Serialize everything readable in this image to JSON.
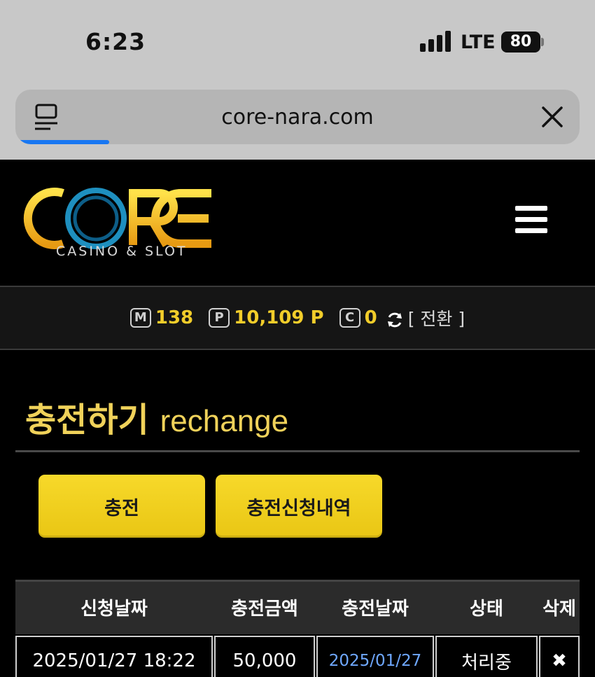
{
  "status_bar": {
    "time": "6:23",
    "network": "LTE",
    "battery": "80"
  },
  "browser": {
    "url": "core-nara.com"
  },
  "site": {
    "logo_text": "CORE",
    "logo_sub": "CASINO & SLOT"
  },
  "balance": {
    "money_icon": "M",
    "money": "138",
    "point_icon": "P",
    "points": "10,109 P",
    "coin_icon": "C",
    "coin": "0",
    "convert_label": "[ 전환 ]"
  },
  "page": {
    "title_ko": "충전하기",
    "title_en": "rechange"
  },
  "buttons": {
    "charge": "충전",
    "history": "충전신청내역"
  },
  "table": {
    "headers": [
      "신청날짜",
      "충전금액",
      "충전날짜",
      "상태",
      "삭제"
    ],
    "rows": [
      {
        "request_date": "2025/01/27 18:22",
        "amount": "50,000",
        "charge_date": "2025/01/27",
        "status": "처리중",
        "delete": "✖"
      }
    ]
  },
  "colors": {
    "accent": "#f2cd2a",
    "button": "#f0cf1e",
    "link": "#6fa8ff",
    "logo_ring": "#1e8fbf"
  }
}
